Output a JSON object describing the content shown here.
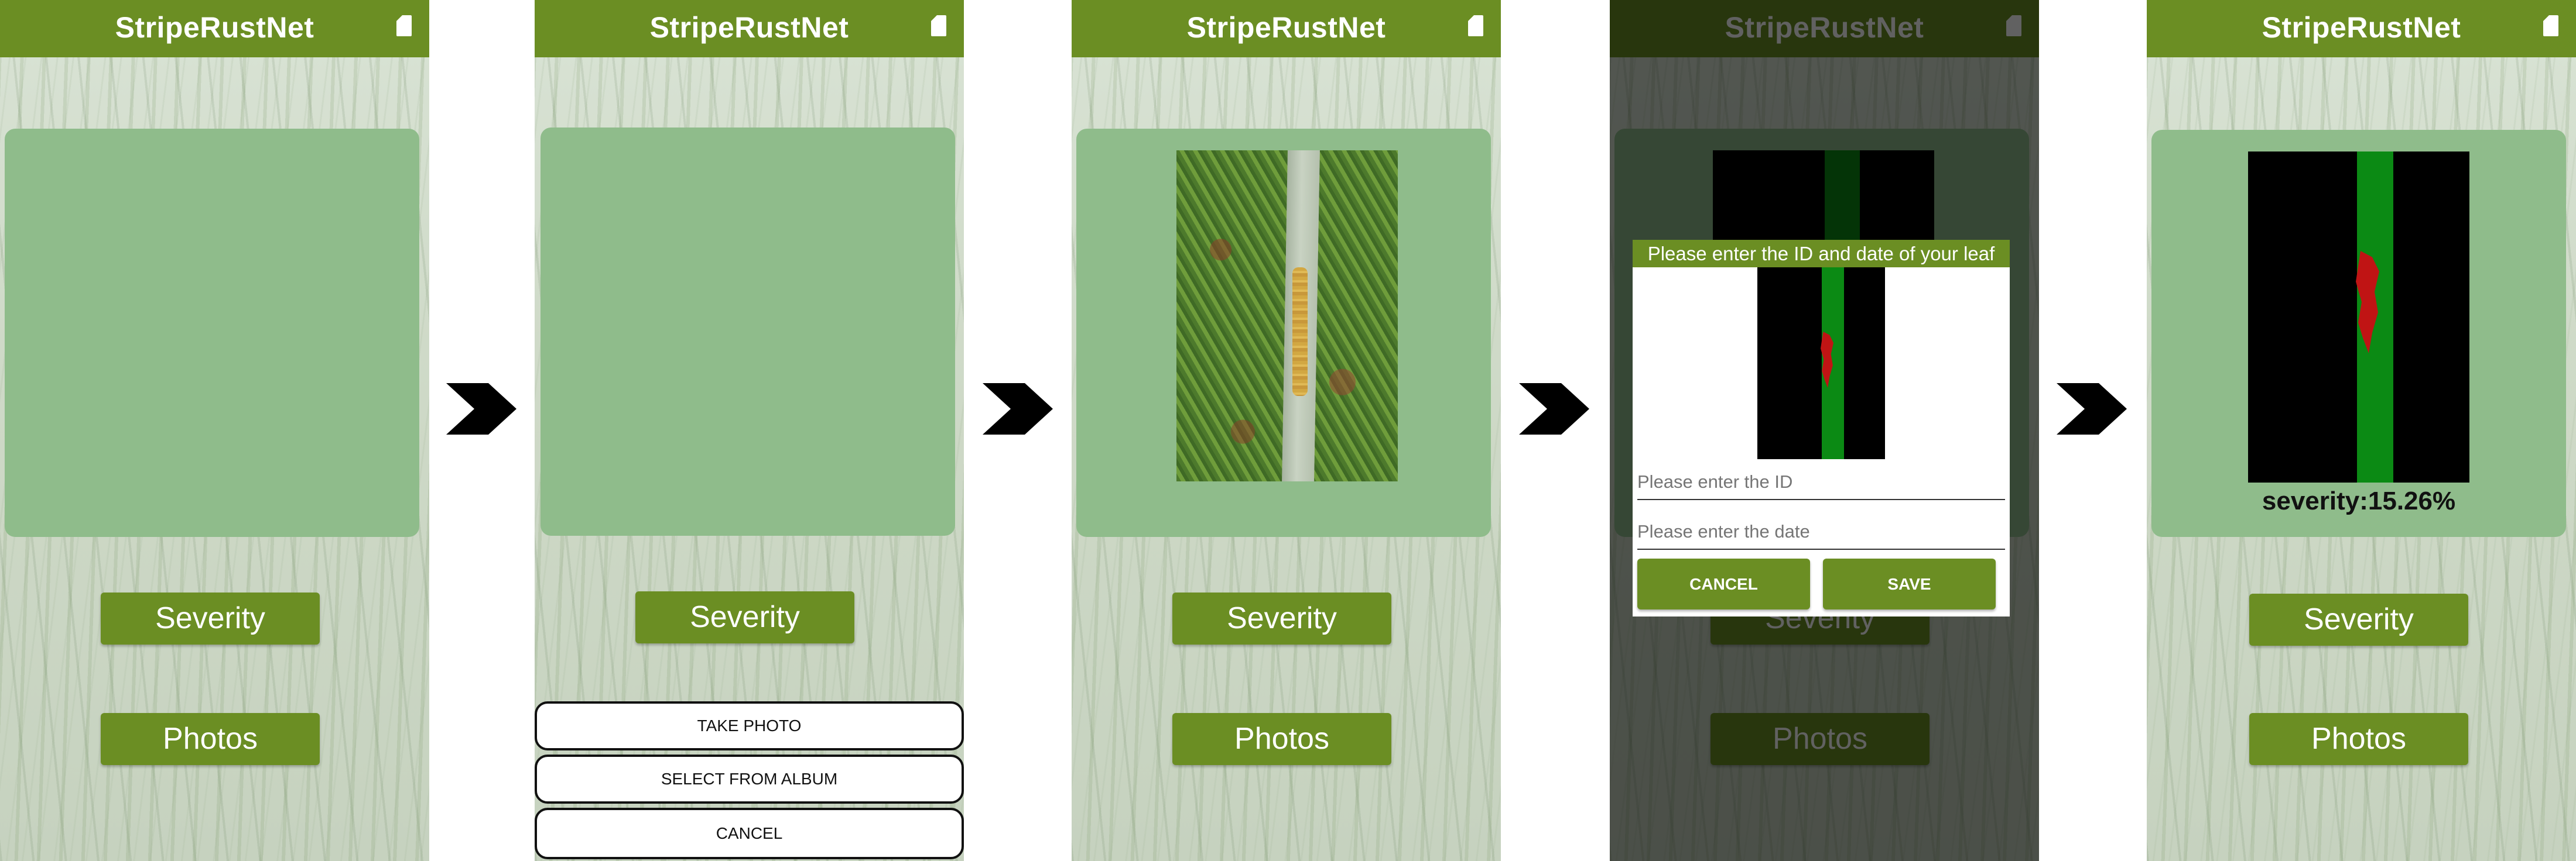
{
  "app": {
    "title": "StripeRustNet"
  },
  "icons": {
    "appbar_icon": "document-icon",
    "transition": "chevron-right-icon"
  },
  "colors": {
    "appbar": "#6b8e23",
    "panel": "#8fbc8b",
    "button": "#6b8e23",
    "seg_leaf": "#0b8a14",
    "seg_rust": "#c01414"
  },
  "buttons": {
    "severity": "Severity",
    "photos": "Photos"
  },
  "screens": [
    {
      "step": 1,
      "state": "empty"
    },
    {
      "step": 2,
      "state": "photo-source-sheet",
      "sheet": {
        "take_photo": "TAKE PHOTO",
        "select_from_album": "SELECT FROM ALBUM",
        "cancel": "CANCEL"
      }
    },
    {
      "step": 3,
      "state": "leaf-photo-loaded"
    },
    {
      "step": 4,
      "state": "save-dialog",
      "dialog": {
        "title": "Please enter the ID and date of your leaf",
        "id_placeholder": "Please enter the ID",
        "date_placeholder": "Please enter the date",
        "cancel": "CANCEL",
        "save": "SAVE"
      }
    },
    {
      "step": 5,
      "state": "result",
      "severity_text": "severity:15.26%"
    }
  ]
}
